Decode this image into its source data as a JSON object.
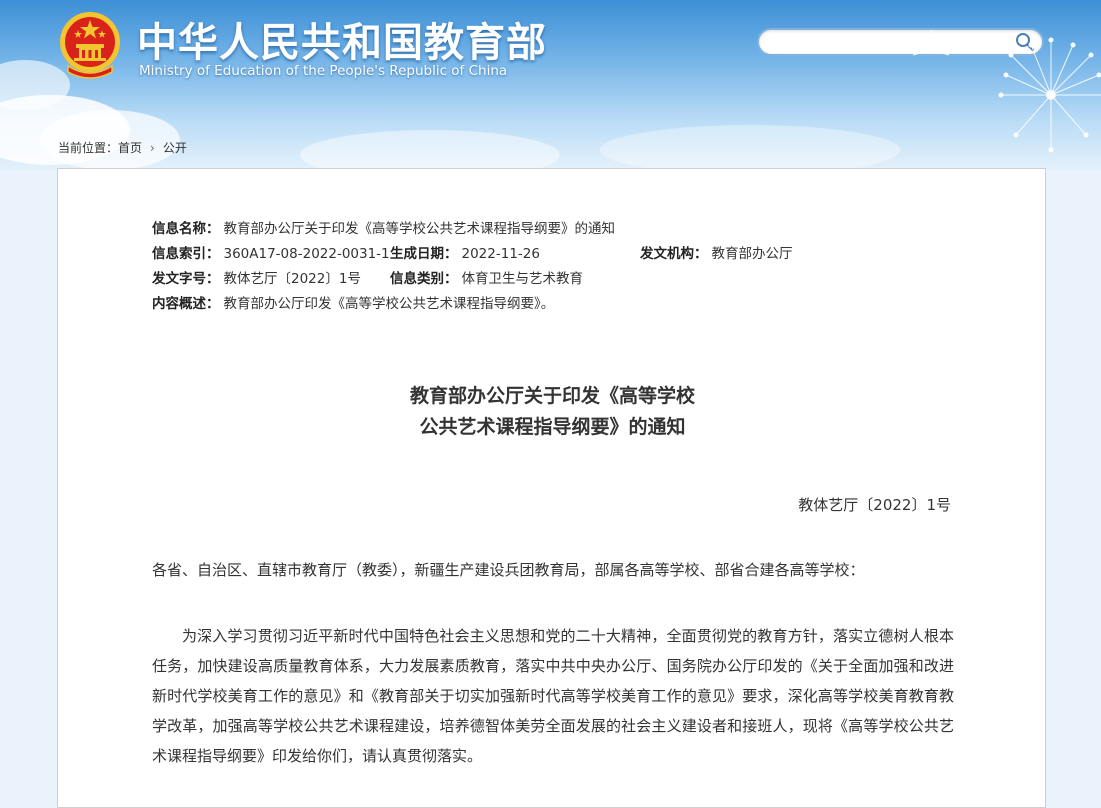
{
  "header": {
    "title_cn": "中华人民共和国教育部",
    "title_en": "Ministry of Education of the People's Republic of China",
    "search_placeholder": "",
    "search_icon": "search-icon",
    "emblem_icon": "national-emblem-icon"
  },
  "breadcrumb": {
    "prefix": "当前位置：",
    "items": [
      "首页",
      "公开"
    ],
    "separator": "›"
  },
  "meta": {
    "name_label": "信息名称：",
    "name_value": "教育部办公厅关于印发《高等学校公共艺术课程指导纲要》的通知",
    "index_label": "信息索引：",
    "index_value": "360A17-08-2022-0031-1",
    "date_label": "生成日期：",
    "date_value": "2022-11-26",
    "org_label": "发文机构：",
    "org_value": "教育部办公厅",
    "doc_label": "发文字号：",
    "doc_value": "教体艺厅〔2022〕1号",
    "category_label": "信息类别：",
    "category_value": "体育卫生与艺术教育",
    "summary_label": "内容概述：",
    "summary_value": "教育部办公厅印发《高等学校公共艺术课程指导纲要》。"
  },
  "document": {
    "title_line1": "教育部办公厅关于印发《高等学校",
    "title_line2": "公共艺术课程指导纲要》的通知",
    "number": "教体艺厅〔2022〕1号",
    "addressee": "各省、自治区、直辖市教育厅（教委），新疆生产建设兵团教育局，部属各高等学校、部省合建各高等学校：",
    "paragraph1": "为深入学习贯彻习近平新时代中国特色社会主义思想和党的二十大精神，全面贯彻党的教育方针，落实立德树人根本任务，加快建设高质量教育体系，大力发展素质教育，落实中共中央办公厅、国务院办公厅印发的《关于全面加强和改进新时代学校美育工作的意见》和《教育部关于切实加强新时代高等学校美育工作的意见》要求，深化高等学校美育教育教学改革，加强高等学校公共艺术课程建设，培养德智体美劳全面发展的社会主义建设者和接班人，现将《高等学校公共艺术课程指导纲要》印发给你们，请认真贯彻落实。"
  },
  "colors": {
    "header_top": "#3d8fd6",
    "header_bottom": "#e4f1fb",
    "emblem_red": "#d9231a",
    "emblem_gold": "#f3c530"
  }
}
